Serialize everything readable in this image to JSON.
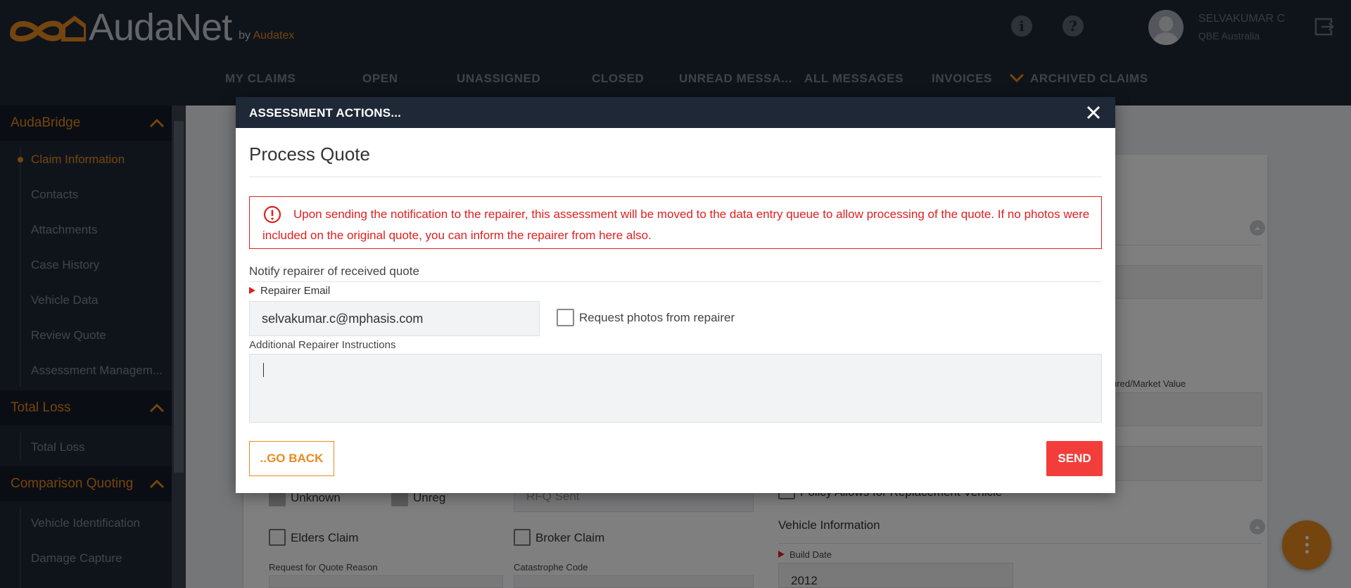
{
  "app": {
    "logo_text": "AudaNet",
    "logo_by": "by",
    "logo_brand": "Audatex"
  },
  "header": {
    "info_icon": "info-icon",
    "help_icon": "help-icon",
    "user_name": "SELVAKUMAR C",
    "user_org": "QBE Australia",
    "logout_icon": "logout-icon"
  },
  "nav": {
    "items": [
      "MY CLAIMS",
      "OPEN",
      "UNASSIGNED",
      "CLOSED",
      "UNREAD MESSA...",
      "ALL MESSAGES",
      "INVOICES",
      "ARCHIVED CLAIMS"
    ]
  },
  "sidebar": {
    "sections": [
      {
        "title": "AudaBridge",
        "items": [
          "Claim Information",
          "Contacts",
          "Attachments",
          "Case History",
          "Vehicle Data",
          "Review Quote",
          "Assessment Managem..."
        ]
      },
      {
        "title": "Total Loss",
        "items": [
          "Total Loss"
        ]
      },
      {
        "title": "Comparison Quoting",
        "items": [
          "Vehicle Identification",
          "Damage Capture"
        ]
      }
    ],
    "active_item": "Claim Information"
  },
  "background_form": {
    "insured_market_value_label": "ured/Market Value",
    "unknown_label": "Unknown",
    "unreg_label": "Unreg",
    "rfq_status": "RFQ Sent",
    "policy_label": "Policy Allows for Replacement Vehicle",
    "vehicle_info_title": "Vehicle Information",
    "elders_claim_label": "Elders Claim",
    "broker_claim_label": "Broker Claim",
    "rfq_reason_label": "Request for Quote Reason",
    "catastrophe_label": "Catastrophe Code",
    "build_date_label": "Build Date",
    "build_date_value": "2012"
  },
  "modal": {
    "title": "ASSESSMENT ACTIONS...",
    "heading": "Process Quote",
    "alert_text": "Upon sending the notification to the repairer, this assessment will be moved to the data entry queue to allow processing of the quote. If no photos were included on the original quote, you can inform the repairer from here also.",
    "notify_label": "Notify repairer of received quote",
    "email_label": "Repairer Email",
    "email_value": "selvakumar.c@mphasis.com",
    "request_photos_label": "Request photos from repairer",
    "request_photos_checked": false,
    "instructions_label": "Additional Repairer Instructions",
    "instructions_value": "",
    "back_label": "..GO BACK",
    "send_label": "SEND"
  },
  "colors": {
    "header_bg": "#1f2836",
    "accent_orange": "#e98a1f",
    "alert_red": "#e02020",
    "send_button": "#f33d3a"
  }
}
